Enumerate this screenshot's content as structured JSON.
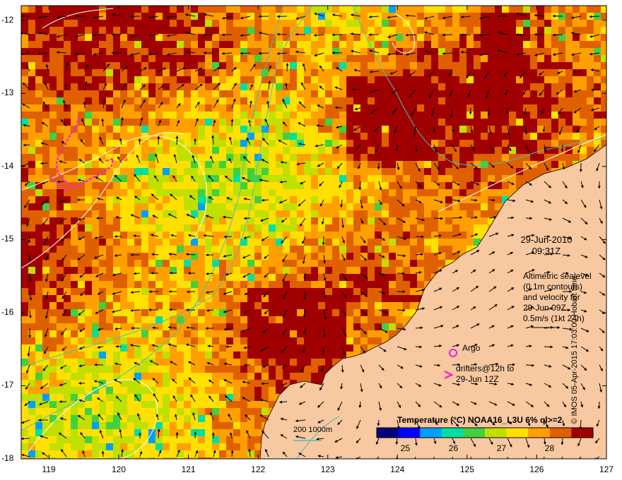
{
  "map": {
    "title": "",
    "x_ticks": [
      "119",
      "120",
      "121",
      "122",
      "123",
      "124",
      "125",
      "126",
      "127"
    ],
    "y_ticks": [
      "-12",
      "-13",
      "-14",
      "-15",
      "-16",
      "-17",
      "-18"
    ],
    "extent": {
      "lon": [
        118.6,
        127.0
      ],
      "lat": [
        -18.0,
        -11.8
      ]
    },
    "land_color": "#f8c8a0",
    "ocean_palette": [
      "#000080",
      "#0000ff",
      "#00a0ff",
      "#00e0a0",
      "#40d040",
      "#c0e000",
      "#ffe000",
      "#ffa000",
      "#e06000",
      "#a00000"
    ]
  },
  "annotations": {
    "date": "29-Jun-2010",
    "time": "09:31Z",
    "altimetry_1": "Altimetric sealevel",
    "altimetry_2": "(0.1m contours)",
    "altimetry_3": "and velocity for",
    "altimetry_4": "29-Jun 09Z",
    "velocity_scale": "0.5m/s (1kt 24h)",
    "argo_label": "Argo",
    "drifters_1": "drifters@12h to",
    "drifters_2": "29-Jun 12Z",
    "depth_label": "200  1000m",
    "credit": "© IMOS 05-Apr-2015 17:03:00 Hobart time"
  },
  "colorbar": {
    "title": "Temperature (°C) NOAA16_L3U 6% ql>=2",
    "ticks": [
      "25",
      "26",
      "27",
      "28"
    ],
    "range": [
      24.4,
      28.9
    ],
    "colors": [
      "#000080",
      "#0000ff",
      "#00a0ff",
      "#00e0a0",
      "#40d040",
      "#c0e000",
      "#ffe000",
      "#ffa000",
      "#e06000",
      "#a00000"
    ]
  },
  "colors": {
    "argo": "#e020e0",
    "drifter": "#ff20d0",
    "contour": "#ffffff",
    "isobath": "#40c0c0"
  }
}
